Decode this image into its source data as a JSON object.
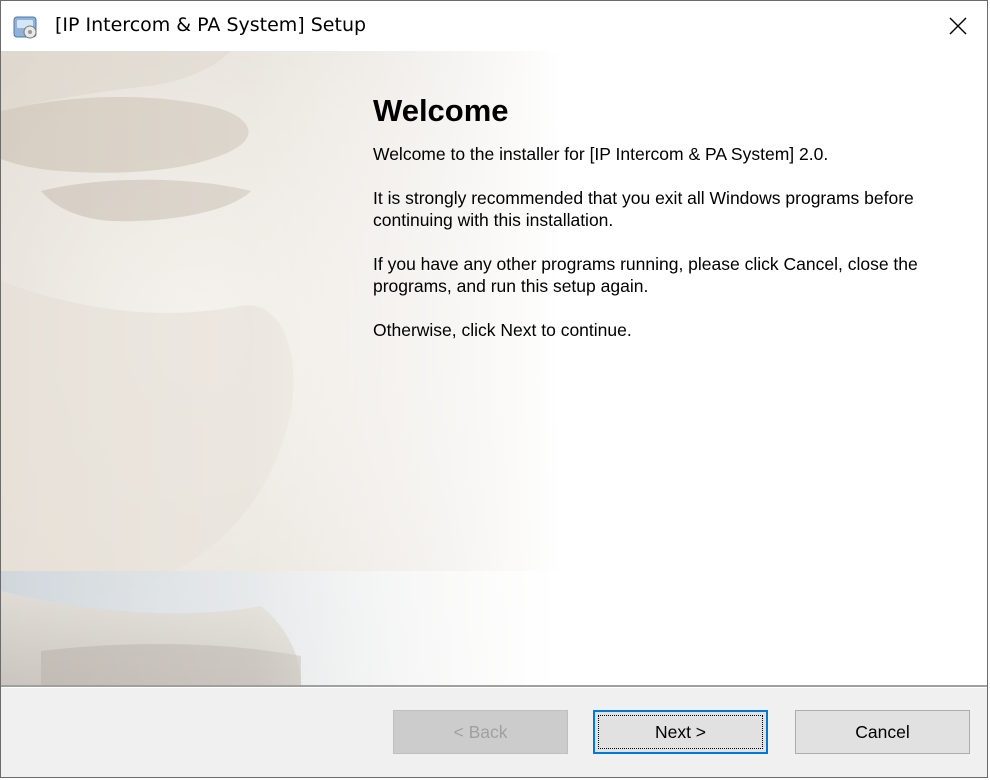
{
  "window": {
    "title": "[IP Intercom & PA System] Setup"
  },
  "welcome": {
    "heading": "Welcome",
    "paragraphs": [
      "Welcome to the installer for [IP Intercom & PA System] 2.0.",
      "It is strongly recommended that you exit all Windows programs before continuing with this installation.",
      "If you have any other programs running, please click Cancel, close the programs, and run this setup again.",
      "Otherwise, click Next to continue."
    ]
  },
  "buttons": {
    "back": "< Back",
    "next": "Next >",
    "cancel": "Cancel"
  },
  "icons": {
    "app": "installer-icon",
    "close": "close-icon"
  },
  "colors": {
    "focus_border": "#0078d7",
    "button_bg": "#e1e1e1",
    "footer_bg": "#f0f0f0"
  }
}
